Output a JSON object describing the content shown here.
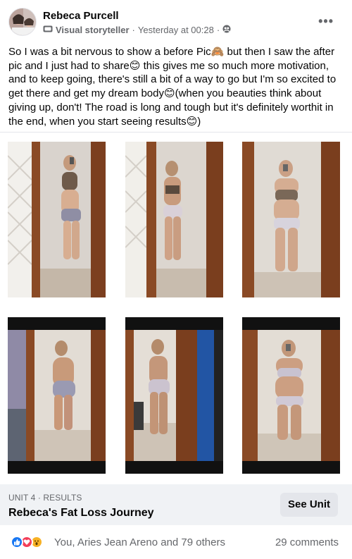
{
  "post": {
    "author": "Rebeca Purcell",
    "badge": "Visual storyteller",
    "time": "Yesterday at 00:28",
    "separator": "·",
    "more_icon": "ellipsis-icon",
    "text": "So I was a bit nervous to show a before Pic🙈 but then I saw the after pic and I just had to share😊 this gives me so much more motivation, and to keep going, there's still a bit of a way to go but I'm so excited to get there and get my dream body😊(when you beauties think about giving up, don't! The road is long and tough but it's definitely worthit in the end, when you start seeing results😊)"
  },
  "link_preview": {
    "unit": "UNIT 4 · RESULTS",
    "title": "Rebeca's Fat Loss Journey",
    "button": "See Unit"
  },
  "reactions": {
    "icons": [
      "like-icon",
      "love-icon",
      "wow-icon"
    ],
    "colors": {
      "like": "#1877f2",
      "love": "#f33e58",
      "wow": "#f7b125"
    },
    "summary": "You, Aries Jean Areno and 79 others",
    "comments": "29 comments"
  },
  "colors": {
    "card": "#ffffff",
    "secondary_text": "#65676b",
    "preview_bg": "#f0f2f5",
    "button_bg": "#e4e6eb"
  }
}
